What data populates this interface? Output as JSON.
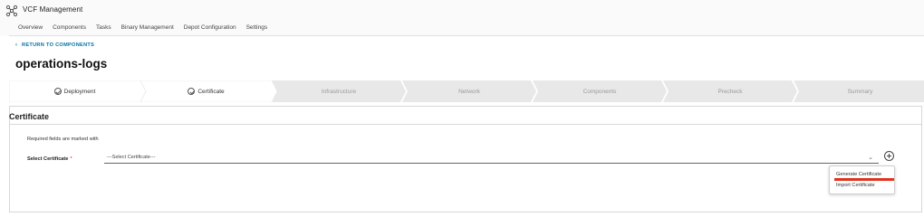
{
  "app": {
    "title": "VCF Management",
    "logo_icon": "vmware-logo-icon"
  },
  "nav": {
    "items": [
      {
        "label": "Overview"
      },
      {
        "label": "Components"
      },
      {
        "label": "Tasks"
      },
      {
        "label": "Binary Management"
      },
      {
        "label": "Depot Configuration"
      },
      {
        "label": "Settings"
      }
    ]
  },
  "back_link": {
    "label": "RETURN TO COMPONENTS",
    "icon": "chevron-left-icon"
  },
  "page": {
    "title": "operations-logs"
  },
  "stepper": {
    "steps": [
      {
        "label": "Deployment",
        "state": "completed"
      },
      {
        "label": "Certificate",
        "state": "current"
      },
      {
        "label": "Infrastructure",
        "state": "pending"
      },
      {
        "label": "Network",
        "state": "pending"
      },
      {
        "label": "Components",
        "state": "pending"
      },
      {
        "label": "Precheck",
        "state": "pending"
      },
      {
        "label": "Summary",
        "state": "pending"
      }
    ]
  },
  "certificate": {
    "title": "Certificate",
    "required_note": "Required fields are marked with",
    "select_label": "Select Certificate",
    "required_marker": "*",
    "select_value": "---Select Certificate---"
  },
  "dropdown": {
    "items": [
      {
        "label": "Generate Certificate"
      },
      {
        "label": "Import Certificate"
      }
    ]
  },
  "colors": {
    "accent_link": "#0072a3",
    "step_active_bg": "#ffffff",
    "step_pending_bg": "#e8e8e8",
    "highlight_red": "#e3321b"
  }
}
